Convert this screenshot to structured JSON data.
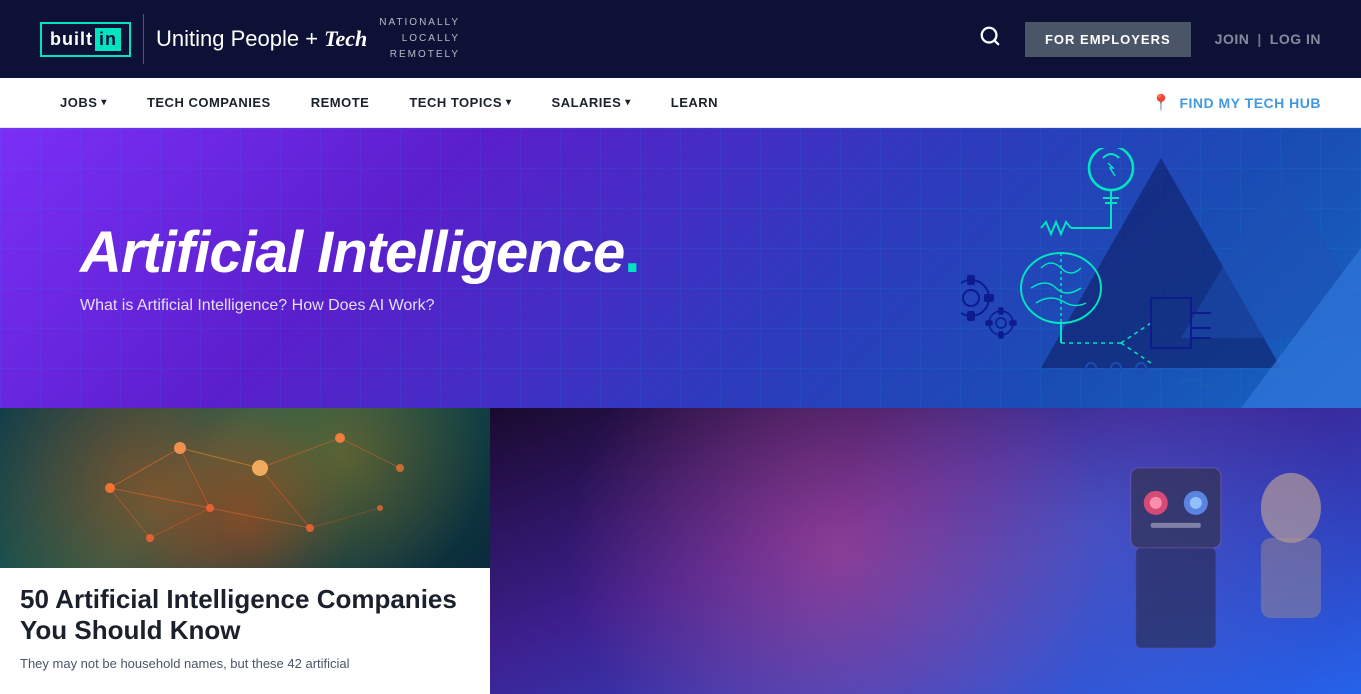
{
  "header": {
    "logo": {
      "built": "built",
      "in": "in"
    },
    "tagline": {
      "prefix": "Uniting People +",
      "tech": "Tech",
      "sub1": "NATIONALLY",
      "sub2": "LOCALLY",
      "sub3": "REMOTELY"
    },
    "forEmployers": "FOR EMPLOYERS",
    "join": "JOIN",
    "login": "LOG IN",
    "divider": "|"
  },
  "nav": {
    "items": [
      {
        "label": "JOBS",
        "hasDropdown": true
      },
      {
        "label": "TECH COMPANIES",
        "hasDropdown": false
      },
      {
        "label": "REMOTE",
        "hasDropdown": false
      },
      {
        "label": "TECH TOPICS",
        "hasDropdown": true
      },
      {
        "label": "SALARIES",
        "hasDropdown": true
      },
      {
        "label": "LEARN",
        "hasDropdown": false
      }
    ],
    "techHub": "FIND MY TECH HUB"
  },
  "hero": {
    "title": "Artificial Intelligence",
    "dot": ".",
    "subtitle": "What is Artificial Intelligence? How Does AI Work?"
  },
  "cards": [
    {
      "title": "50 Artificial Intelligence Companies You Should Know",
      "description": "They may not be household names, but these 42 artificial"
    }
  ]
}
